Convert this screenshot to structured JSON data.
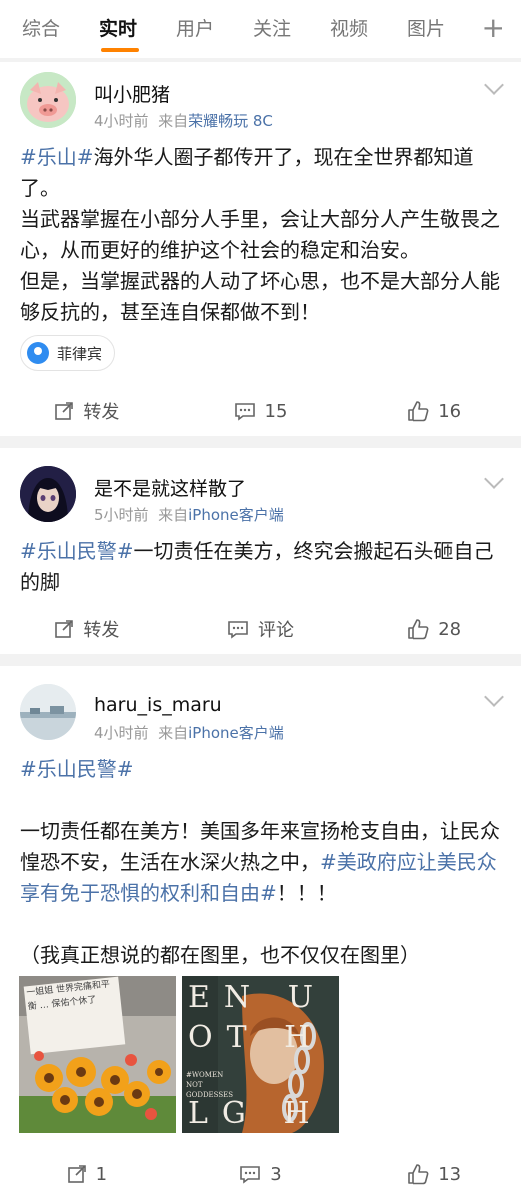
{
  "tabs": [
    {
      "label": "综合"
    },
    {
      "label": "实时"
    },
    {
      "label": "用户"
    },
    {
      "label": "关注"
    },
    {
      "label": "视频"
    },
    {
      "label": "图片"
    }
  ],
  "active_tab": "实时",
  "tab_add_label": "+",
  "posts": [
    {
      "author": "叫小肥猪",
      "time": "4小时前",
      "source_prefix": "来自",
      "source": "荣耀畅玩 8C",
      "tag1": "#乐山#",
      "line1": "海外华人圈子都传开了，现在全世界都知道了。",
      "line2": "当武器掌握在小部分人手里，会让大部分人产生敬畏之心，从而更好的维护这个社会的稳定和治安。",
      "line3": "但是，当掌握武器的人动了坏心思，也不是大部分人能够反抗的，甚至连自保都做不到！",
      "location": "菲律宾",
      "repost": "转发",
      "comments": "15",
      "likes": "16"
    },
    {
      "author": "是不是就这样散了",
      "time": "5小时前",
      "source_prefix": "来自",
      "source": "iPhone客户端",
      "tag1": "#乐山民警#",
      "line1": "一切责任在美方，终究会搬起石头砸自己的脚",
      "repost": "转发",
      "comments": "评论",
      "likes": "28"
    },
    {
      "author": "haru_is_maru",
      "time": "4小时前",
      "source_prefix": "来自",
      "source": "iPhone客户端",
      "tag1": "#乐山民警#",
      "para_a": "一切责任都在美方！美国多年来宣扬枪支自由，让民众惶恐不安，生活在水深火热之中，",
      "tag2": "#美政府应让美民众享有免于恐惧的权利和自由#",
      "para_b": "！！！",
      "para_c": "（我真正想说的都在图里，也不仅仅在图里）",
      "photo1_text": "一姐姐 世界完痛和平衡 … 保佑个休了",
      "photo2_letters": [
        "E",
        "N",
        "U",
        "O",
        "T",
        "H",
        "L",
        "G",
        "H"
      ],
      "photo2_caption": "#WOMEN NOT GODDESSES",
      "repost": "1",
      "comments": "3",
      "likes": "13"
    }
  ],
  "colors": {
    "accent": "#ff8200",
    "link": "#4b72a8",
    "location_pin": "#2f8cf0"
  }
}
